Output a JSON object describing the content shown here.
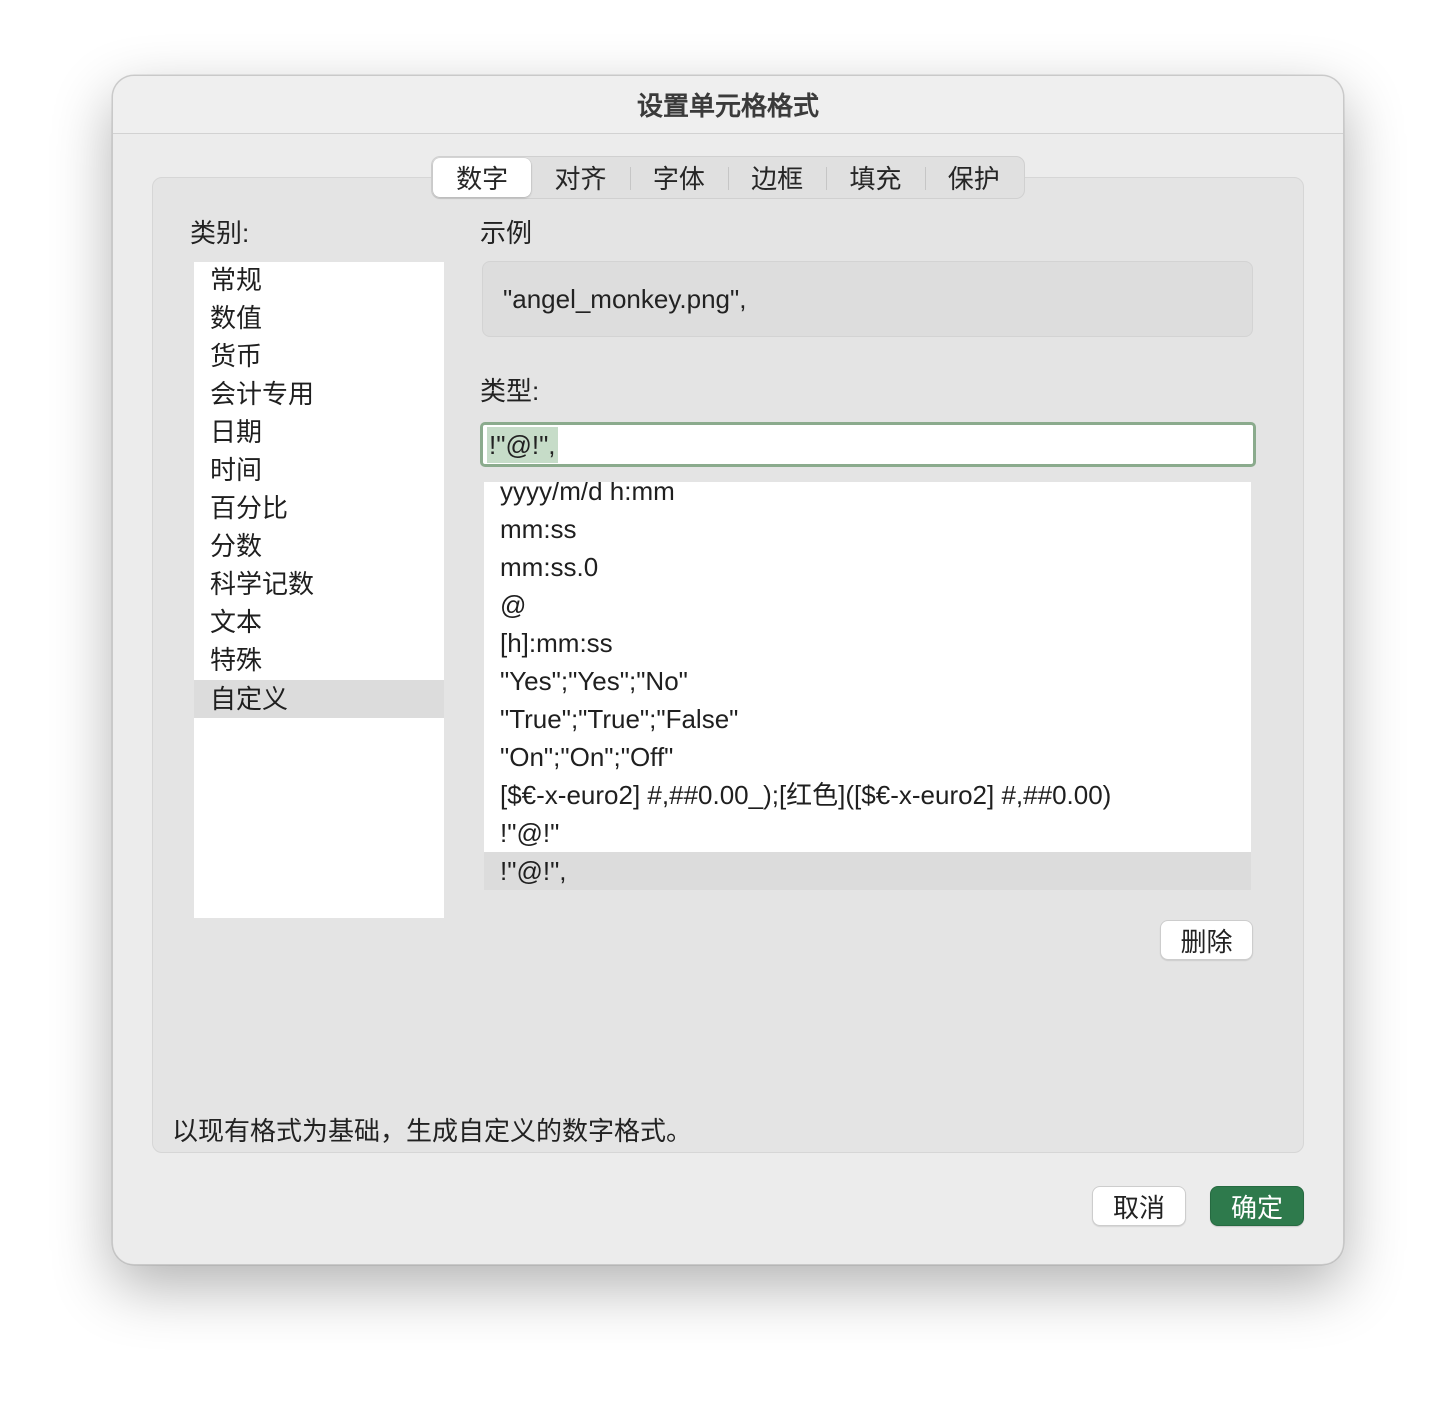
{
  "window": {
    "title": "设置单元格格式"
  },
  "tabs": [
    {
      "label": "数字",
      "selected": true
    },
    {
      "label": "对齐"
    },
    {
      "label": "字体"
    },
    {
      "label": "边框"
    },
    {
      "label": "填充"
    },
    {
      "label": "保护"
    }
  ],
  "category": {
    "label": "类别:",
    "items": [
      {
        "label": "常规"
      },
      {
        "label": "数值"
      },
      {
        "label": "货币"
      },
      {
        "label": "会计专用"
      },
      {
        "label": "日期"
      },
      {
        "label": "时间"
      },
      {
        "label": "百分比"
      },
      {
        "label": "分数"
      },
      {
        "label": "科学记数"
      },
      {
        "label": "文本"
      },
      {
        "label": "特殊"
      },
      {
        "label": "自定义",
        "selected": true
      }
    ]
  },
  "sample": {
    "label": "示例",
    "value": "\"angel_monkey.png\","
  },
  "type": {
    "label": "类型:",
    "value": "!\"@!\",",
    "items": [
      {
        "label": "yyyy/m/d h:mm"
      },
      {
        "label": "mm:ss"
      },
      {
        "label": "mm:ss.0"
      },
      {
        "label": "@"
      },
      {
        "label": "[h]:mm:ss"
      },
      {
        "label": "\"Yes\";\"Yes\";\"No\""
      },
      {
        "label": "\"True\";\"True\";\"False\""
      },
      {
        "label": "\"On\";\"On\";\"Off\""
      },
      {
        "label": "[$€-x-euro2] #,##0.00_);[红色]([$€-x-euro2] #,##0.00)"
      },
      {
        "label": "!\"@!\""
      },
      {
        "label": "!\"@!\",",
        "selected": true
      }
    ]
  },
  "delete_label": "删除",
  "description": "以现有格式为基础，生成自定义的数字格式。",
  "buttons": {
    "cancel": "取消",
    "ok": "确定"
  },
  "colors": {
    "accent": "#2e7a4c",
    "focus_ring": "#8bab8d",
    "selection": "#c6dcc8",
    "row_selected": "#dcdcdc"
  }
}
